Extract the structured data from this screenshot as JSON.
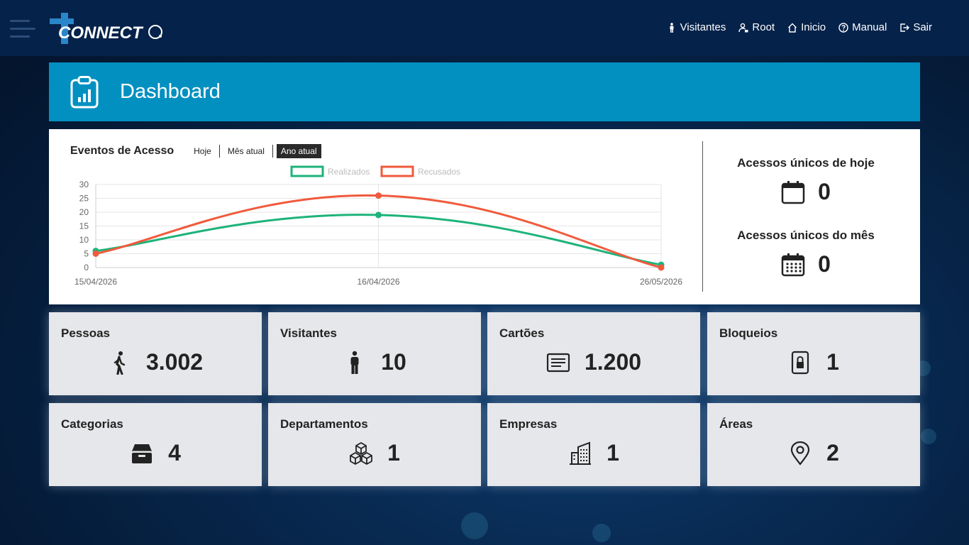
{
  "nav": {
    "items": [
      {
        "label": "Visitantes",
        "icon": "person-icon"
      },
      {
        "label": "Root",
        "icon": "user-lock-icon"
      },
      {
        "label": "Inicio",
        "icon": "home-icon"
      },
      {
        "label": "Manual",
        "icon": "help-circle-icon"
      },
      {
        "label": "Sair",
        "icon": "logout-icon"
      }
    ]
  },
  "logo": {
    "text": "CONNECT"
  },
  "banner": {
    "title": "Dashboard",
    "icon": "clipboard-chart-icon"
  },
  "chart_panel": {
    "title": "Eventos de Acesso",
    "filters": [
      "Hoje",
      "Mês atual",
      "Ano atual"
    ],
    "active_filter": "Ano atual"
  },
  "chart_data": {
    "type": "line",
    "x": [
      "15/04/2026",
      "16/04/2026",
      "26/05/2026"
    ],
    "series": [
      {
        "name": "Realizados",
        "values": [
          6,
          19,
          1
        ],
        "color": "#1db37a"
      },
      {
        "name": "Recusados",
        "values": [
          5,
          26,
          0
        ],
        "color": "#f05a3c"
      }
    ],
    "ylim": [
      0,
      30
    ],
    "yticks": [
      0,
      5,
      10,
      15,
      20,
      25,
      30
    ],
    "grid": true,
    "legend": "top"
  },
  "unique": {
    "today": {
      "label": "Acessos únicos de hoje",
      "value": "0",
      "icon": "calendar-icon"
    },
    "month": {
      "label": "Acessos únicos do mês",
      "value": "0",
      "icon": "calendar-grid-icon"
    }
  },
  "cards": [
    {
      "label": "Pessoas",
      "value": "3.002",
      "icon": "walking-person-icon"
    },
    {
      "label": "Visitantes",
      "value": "10",
      "icon": "standing-person-icon"
    },
    {
      "label": "Cartões",
      "value": "1.200",
      "icon": "card-lines-icon"
    },
    {
      "label": "Bloqueios",
      "value": "1",
      "icon": "lock-icon"
    },
    {
      "label": "Categorias",
      "value": "4",
      "icon": "box-icon"
    },
    {
      "label": "Departamentos",
      "value": "1",
      "icon": "cubes-icon"
    },
    {
      "label": "Empresas",
      "value": "1",
      "icon": "building-icon"
    },
    {
      "label": "Áreas",
      "value": "2",
      "icon": "location-pin-icon"
    }
  ]
}
